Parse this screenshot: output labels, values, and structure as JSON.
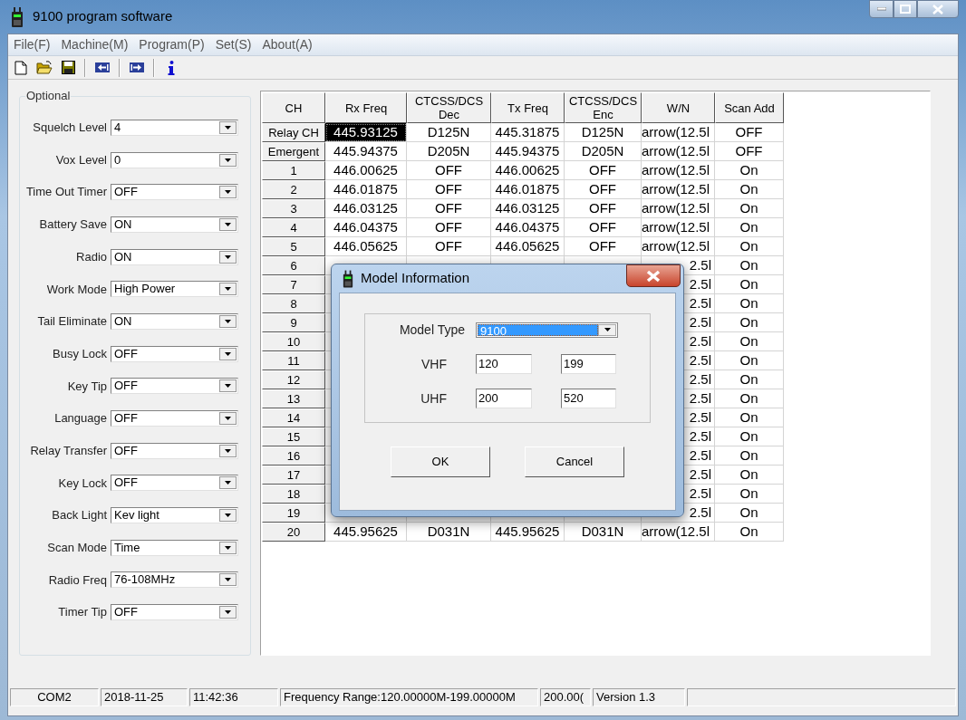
{
  "window": {
    "title": "9100 program software"
  },
  "menu": [
    "File(F)",
    "Machine(M)",
    "Program(P)",
    "Set(S)",
    "About(A)"
  ],
  "toolbar": [
    {
      "kind": "new"
    },
    {
      "kind": "open"
    },
    {
      "kind": "save"
    },
    {
      "kind": "separator"
    },
    {
      "kind": "read"
    },
    {
      "kind": "separator"
    },
    {
      "kind": "write"
    },
    {
      "kind": "separator"
    },
    {
      "kind": "info"
    }
  ],
  "optional": {
    "title": "Optional",
    "fields": [
      {
        "label": "Squelch Level",
        "value": "4"
      },
      {
        "label": "Vox Level",
        "value": "0"
      },
      {
        "label": "Time Out Timer",
        "value": "OFF"
      },
      {
        "label": "Battery Save",
        "value": "ON"
      },
      {
        "label": "Radio",
        "value": "ON"
      },
      {
        "label": "Work Mode",
        "value": "High Power"
      },
      {
        "label": "Tail Eliminate",
        "value": "ON"
      },
      {
        "label": "Busy Lock",
        "value": "OFF"
      },
      {
        "label": "Key Tip",
        "value": "OFF"
      },
      {
        "label": "Language",
        "value": "OFF"
      },
      {
        "label": "Relay Transfer",
        "value": "OFF"
      },
      {
        "label": "Key Lock",
        "value": "OFF"
      },
      {
        "label": "Back Light",
        "value": "Kev light"
      },
      {
        "label": "Scan Mode",
        "value": "Time"
      },
      {
        "label": "Radio Freq",
        "value": "76-108MHz"
      },
      {
        "label": "Timer Tip",
        "value": "OFF"
      }
    ]
  },
  "table": {
    "columns": [
      "CH",
      "Rx Freq",
      "CTCSS/DCS\nDec",
      "Tx Freq",
      "CTCSS/DCS\nEnc",
      "W/N",
      "Scan Add"
    ],
    "rows": [
      {
        "ch": "Relay CH",
        "rx_freq": "445.93125",
        "dec": "D125N",
        "tx_freq": "445.31875",
        "enc": "D125N",
        "w_n": "arrow(12.5l",
        "scan_add": "OFF",
        "selected": true,
        "covered": false
      },
      {
        "ch": "Emergent",
        "rx_freq": "445.94375",
        "dec": "D205N",
        "tx_freq": "445.94375",
        "enc": "D205N",
        "w_n": "arrow(12.5l",
        "scan_add": "OFF",
        "selected": false,
        "covered": false
      },
      {
        "ch": "1",
        "rx_freq": "446.00625",
        "dec": "OFF",
        "tx_freq": "446.00625",
        "enc": "OFF",
        "w_n": "arrow(12.5l",
        "scan_add": "On",
        "selected": false,
        "covered": false
      },
      {
        "ch": "2",
        "rx_freq": "446.01875",
        "dec": "OFF",
        "tx_freq": "446.01875",
        "enc": "OFF",
        "w_n": "arrow(12.5l",
        "scan_add": "On",
        "selected": false,
        "covered": false
      },
      {
        "ch": "3",
        "rx_freq": "446.03125",
        "dec": "OFF",
        "tx_freq": "446.03125",
        "enc": "OFF",
        "w_n": "arrow(12.5l",
        "scan_add": "On",
        "selected": false,
        "covered": false
      },
      {
        "ch": "4",
        "rx_freq": "446.04375",
        "dec": "OFF",
        "tx_freq": "446.04375",
        "enc": "OFF",
        "w_n": "arrow(12.5l",
        "scan_add": "On",
        "selected": false,
        "covered": false
      },
      {
        "ch": "5",
        "rx_freq": "446.05625",
        "dec": "OFF",
        "tx_freq": "446.05625",
        "enc": "OFF",
        "w_n": "arrow(12.5l",
        "scan_add": "On",
        "selected": false,
        "covered": false
      },
      {
        "ch": "6",
        "w_n": "2.5l",
        "scan_add": "On",
        "selected": false,
        "covered": true
      },
      {
        "ch": "7",
        "w_n": "2.5l",
        "scan_add": "On",
        "selected": false,
        "covered": true
      },
      {
        "ch": "8",
        "w_n": "2.5l",
        "scan_add": "On",
        "selected": false,
        "covered": true
      },
      {
        "ch": "9",
        "w_n": "2.5l",
        "scan_add": "On",
        "selected": false,
        "covered": true
      },
      {
        "ch": "10",
        "w_n": "2.5l",
        "scan_add": "On",
        "selected": false,
        "covered": true
      },
      {
        "ch": "11",
        "w_n": "2.5l",
        "scan_add": "On",
        "selected": false,
        "covered": true
      },
      {
        "ch": "12",
        "w_n": "2.5l",
        "scan_add": "On",
        "selected": false,
        "covered": true
      },
      {
        "ch": "13",
        "w_n": "2.5l",
        "scan_add": "On",
        "selected": false,
        "covered": true
      },
      {
        "ch": "14",
        "w_n": "2.5l",
        "scan_add": "On",
        "selected": false,
        "covered": true
      },
      {
        "ch": "15",
        "w_n": "2.5l",
        "scan_add": "On",
        "selected": false,
        "covered": true
      },
      {
        "ch": "16",
        "w_n": "2.5l",
        "scan_add": "On",
        "selected": false,
        "covered": true
      },
      {
        "ch": "17",
        "w_n": "2.5l",
        "scan_add": "On",
        "selected": false,
        "covered": true
      },
      {
        "ch": "18",
        "w_n": "2.5l",
        "scan_add": "On",
        "selected": false,
        "covered": true
      },
      {
        "ch": "19",
        "w_n": "2.5l",
        "scan_add": "On",
        "selected": false,
        "covered": true
      },
      {
        "ch": "20",
        "rx_freq": "445.95625",
        "dec": "D031N",
        "tx_freq": "445.95625",
        "enc": "D031N",
        "w_n": "arrow(12.5l",
        "scan_add": "On",
        "selected": false,
        "covered": false
      }
    ]
  },
  "dialog": {
    "title": "Model Information",
    "model_type": {
      "label": "Model Type",
      "value": "9100",
      "selected": true
    },
    "ranges": [
      {
        "label": "VHF",
        "low": "120",
        "high": "199"
      },
      {
        "label": "UHF",
        "low": "200",
        "high": "520"
      }
    ],
    "buttons": [
      "OK",
      "Cancel"
    ]
  },
  "status_bar": [
    "COM2",
    "2018-11-25",
    "11:42:36",
    "Frequency Range:120.00000M-199.00000M",
    "200.00(",
    "Version 1.3"
  ]
}
